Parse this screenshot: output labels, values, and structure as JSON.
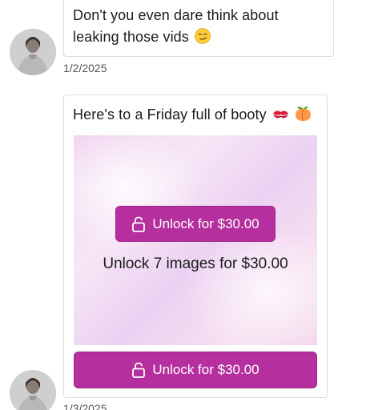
{
  "messages": [
    {
      "text": "Don't you even dare think about leaking those vids",
      "emoji": "smirking-face-emoji",
      "timestamp": "1/2/2025"
    },
    {
      "text": "Here's to a Friday full of booty",
      "emoji": [
        "kiss-mark-emoji",
        "peach-emoji"
      ],
      "locked_media": {
        "overlay_button_label": "Unlock for $30.00",
        "caption": "Unlock 7 images for $30.00",
        "button_label": "Unlock for $30.00",
        "icon": "unlock-icon"
      },
      "timestamp": "1/3/2025"
    }
  ],
  "colors": {
    "accent": "#b5309e",
    "bubble_border": "#dcdcdc",
    "media_tint": "#f1d3ee",
    "text": "#1c1c1c",
    "timestamp": "#555555"
  }
}
